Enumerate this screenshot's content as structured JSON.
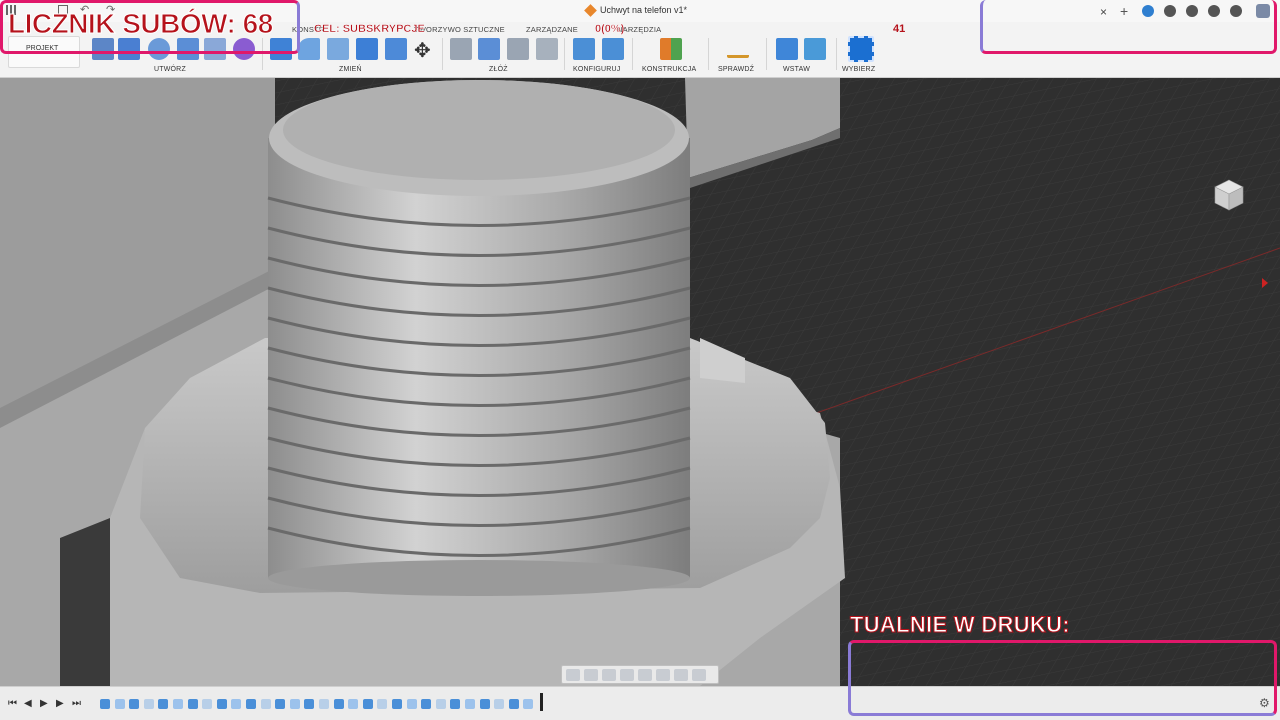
{
  "window": {
    "title": "Uchwyt na telefon v1*"
  },
  "tabs": [
    "KONSTR",
    "TWORZYWO SZTUCZNE",
    "ZARZĄDZANE",
    "NARZĘDZIA"
  ],
  "toolbar": {
    "project_label": "PROJEKT",
    "groups": [
      "UTWÓRZ",
      "ZMIEŃ",
      "ZŁÓŻ",
      "KONFIGURUJ",
      "KONSTRUKCJA",
      "SPRAWDŹ",
      "WSTAW",
      "WYBIERZ"
    ]
  },
  "overlays": {
    "sub_counter": "LICZNIK SUBÓW: 68",
    "goal": "CEL: SUBSKRYPCJE",
    "progress": "0(0%)",
    "count_41": "41",
    "printing": "TUALNIE W DRUKU:"
  },
  "colors": {
    "overlay_red": "#b5121b",
    "frame_pink": "#e0186a",
    "frame_violet": "#8a7bd6",
    "viewport_bg": "#2f2f2f",
    "model_grey": "#bcbcbc"
  },
  "icons": [
    "grid-icon",
    "save-icon",
    "undo-icon",
    "redo-icon",
    "move-icon",
    "ruler-icon",
    "image-icon",
    "select-icon",
    "orbit-icon",
    "pan-icon",
    "zoom-icon",
    "display-icon",
    "gear-icon",
    "close-icon",
    "plus-icon",
    "bell-icon",
    "help-icon",
    "clock-icon"
  ],
  "timeline": {
    "play": "▶",
    "step_back": "◀",
    "step_forward": "▶",
    "to_start": "⏮",
    "to_end": "⏭",
    "settings": "⚙"
  }
}
